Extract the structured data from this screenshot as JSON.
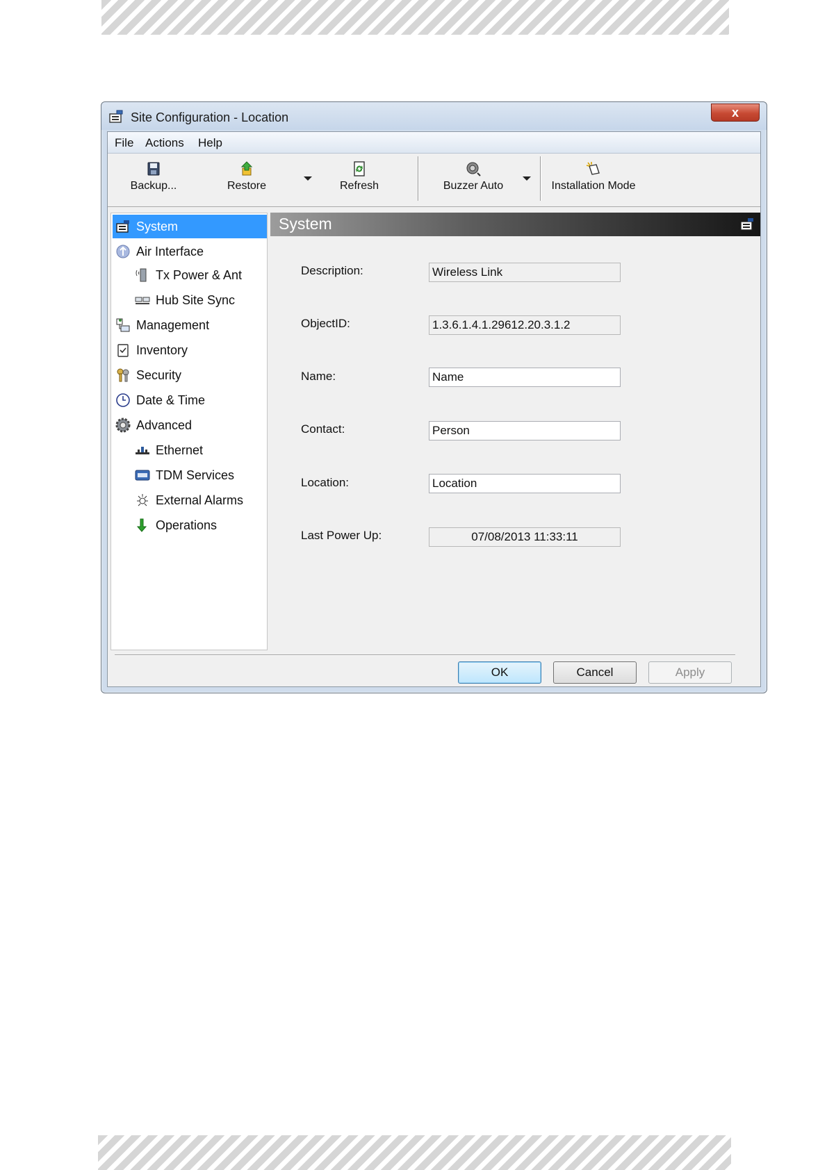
{
  "window": {
    "title": "Site Configuration - Location",
    "close_glyph": "x"
  },
  "menu": [
    "File",
    "Actions",
    "Help"
  ],
  "toolbar": {
    "backup": "Backup...",
    "restore": "Restore",
    "refresh": "Refresh",
    "buzzer": "Buzzer Auto",
    "installation": "Installation Mode"
  },
  "tree": [
    {
      "label": "System",
      "icon": "system-icon",
      "selected": true
    },
    {
      "label": "Air Interface",
      "icon": "air-interface-icon"
    },
    {
      "label": "Tx Power & Ant",
      "icon": "antenna-icon"
    },
    {
      "label": "Hub Site Sync",
      "icon": "hub-sync-icon"
    },
    {
      "label": "Management",
      "icon": "management-icon"
    },
    {
      "label": "Inventory",
      "icon": "inventory-icon"
    },
    {
      "label": "Security",
      "icon": "security-icon"
    },
    {
      "label": "Date & Time",
      "icon": "clock-icon"
    },
    {
      "label": "Advanced",
      "icon": "gear-icon"
    },
    {
      "label": "Ethernet",
      "icon": "ethernet-icon"
    },
    {
      "label": "TDM Services",
      "icon": "tdm-icon"
    },
    {
      "label": "External Alarms",
      "icon": "alarm-icon"
    },
    {
      "label": "Operations",
      "icon": "operations-icon"
    }
  ],
  "panel": {
    "title": "System",
    "fields": {
      "description": {
        "label": "Description:",
        "value": "Wireless Link"
      },
      "objectid": {
        "label": "ObjectID:",
        "value": "1.3.6.1.4.1.29612.20.3.1.2"
      },
      "name": {
        "label": "Name:",
        "value": "Name"
      },
      "contact": {
        "label": "Contact:",
        "value": "Person"
      },
      "location": {
        "label": "Location:",
        "value": "Location"
      },
      "last_power_up": {
        "label": "Last Power Up:",
        "value": "07/08/2013 11:33:11"
      }
    }
  },
  "buttons": {
    "ok": "OK",
    "cancel": "Cancel",
    "apply": "Apply"
  },
  "colors": {
    "selection": "#3399ff",
    "close_button": "#c74a33",
    "header_dark": "#161616"
  }
}
